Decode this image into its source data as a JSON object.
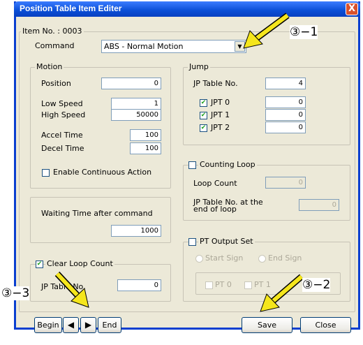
{
  "window": {
    "title": "Position Table Item Editer",
    "close_label": "X"
  },
  "item_no": {
    "label": "Item No. : 0003"
  },
  "command": {
    "label": "Command",
    "value": "ABS - Normal Motion"
  },
  "motion": {
    "legend": "Motion",
    "position_label": "Position",
    "position_value": "0",
    "low_speed_label": "Low Speed",
    "low_speed_value": "1",
    "high_speed_label": "High Speed",
    "high_speed_value": "50000",
    "accel_label": "Accel Time",
    "accel_value": "100",
    "decel_label": "Decel Time",
    "decel_value": "100",
    "continuous_label": "Enable Continuous Action",
    "continuous_checked": false
  },
  "jump": {
    "legend": "Jump",
    "table_label": "JP Table No.",
    "table_value": "4",
    "jpt0_label": "JPT 0",
    "jpt0_value": "0",
    "jpt0_checked": true,
    "jpt1_label": "JPT 1",
    "jpt1_value": "0",
    "jpt1_checked": true,
    "jpt2_label": "JPT 2",
    "jpt2_value": "0",
    "jpt2_checked": true
  },
  "counting_loop": {
    "label": "Counting Loop",
    "loop_count_label": "Loop Count",
    "loop_count_value": "0",
    "jp_end_label_1": "JP Table No. at the",
    "jp_end_label_2": "end of loop",
    "jp_end_value": "0"
  },
  "waiting": {
    "label": "Waiting Time after command",
    "value": "1000"
  },
  "pt_output": {
    "label": "PT Output Set",
    "start_sign": "Start Sign",
    "end_sign": "End Sign",
    "pt0": "PT 0",
    "pt1": "PT 1"
  },
  "clear_loop": {
    "label": "Clear Loop Count",
    "checked": true,
    "jp_table_label": "JP Table No.",
    "jp_table_value": "0"
  },
  "nav": {
    "begin": "Begin",
    "prev": "◀",
    "next": "▶",
    "end": "End"
  },
  "footer": {
    "save": "Save",
    "close": "Close"
  },
  "annotations": {
    "a1": "③−1",
    "a2": "③−2",
    "a3": "③−3",
    "arrow_color": "#f5e61c"
  }
}
